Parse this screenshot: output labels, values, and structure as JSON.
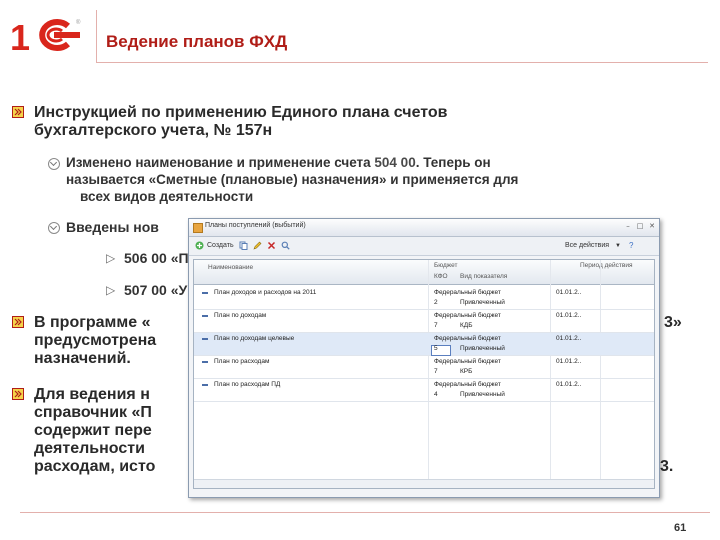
{
  "header": {
    "logo_text": "1С",
    "title": "Ведение планов ФХД"
  },
  "bullets": [
    {
      "line1": "Инструкцией по применению Единого плана счетов",
      "line2": "бухгалтерского учета, № 157н"
    },
    {
      "line1": "В программе «",
      "line1_end": "3»",
      "line2": "предусмотрена",
      "line3": "назначений."
    },
    {
      "line1": "Для ведения н",
      "line2": "справочник «П",
      "line3": "содержит пере",
      "line4": "деятельности",
      "line5": "расходам, исто",
      "line5_end": "3."
    }
  ],
  "sub_bullets": {
    "first_line1_pre": "Изменено наименование и применение счета ",
    "first_line1_acct": "504 00",
    "first_line1_post": ". Теперь он",
    "first_line2": "называется «Сметные (плановые) назначения» и применяется для",
    "first_line3": "всех видов деятельности",
    "second_line1": "Введены нов",
    "arrow_item1": "506 00 «П",
    "arrow_item2": "507 00 «У"
  },
  "window": {
    "title": "Планы поступлений (выбытий)",
    "toolbar": {
      "create_label": "Создать",
      "actions_label": "Все действия"
    },
    "columns": {
      "name": "Наименование",
      "budget": "Бюджет",
      "kfo": "КФО",
      "indicator_type": "Вид показателя",
      "period": "Период действия"
    },
    "rows": [
      {
        "name": "План доходов и расходов на 2011",
        "budget": "Федеральный бюджет",
        "kfo": "2",
        "type": "Привлеченный",
        "period": "01.01.2.."
      },
      {
        "name": "План по доходам",
        "budget": "Федеральный бюджет",
        "kfo": "7",
        "type": "КДБ",
        "period": "01.01.2.."
      },
      {
        "name": "План по доходам целевые",
        "budget": "Федеральный бюджет",
        "kfo": "5",
        "type": "Привлеченный",
        "period": "01.01.2.."
      },
      {
        "name": "План по расходам",
        "budget": "Федеральный бюджет",
        "kfo": "7",
        "type": "КРБ",
        "period": "01.01.2.."
      },
      {
        "name": "План по расходам ПД",
        "budget": "Федеральный бюджет",
        "kfo": "4",
        "type": "Привлеченный",
        "period": "01.01.2.."
      }
    ]
  },
  "footer": {
    "page_number": "61"
  },
  "colors": {
    "accent": "#b01d17",
    "logo_red": "#d9261c",
    "selected_row": "#dfe9f7"
  }
}
